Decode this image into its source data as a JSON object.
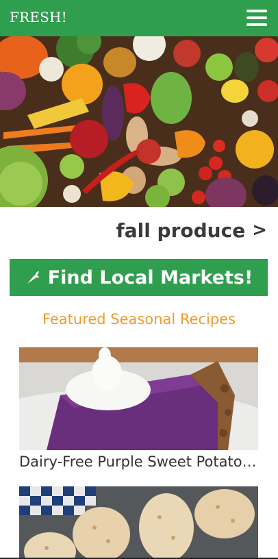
{
  "header": {
    "brand": "FRESH!",
    "menu_icon": "hamburger-menu-icon"
  },
  "hero": {
    "image": "assorted-fruits-and-vegetables"
  },
  "fall_link": {
    "label": "fall produce",
    "chevron": ">"
  },
  "cta": {
    "label": "Find Local Markets!",
    "icon": "carrot-icon"
  },
  "recipes": {
    "heading": "Featured Seasonal Recipes",
    "items": [
      {
        "title": "Dairy-Free Purple Sweet Potato Pie",
        "image": "purple-sweet-potato-pie"
      },
      {
        "title": "",
        "image": "baked-stuffed-potatoes"
      }
    ]
  },
  "colors": {
    "brand_green": "#2f9e4f",
    "accent_orange": "#f39a2c",
    "text_dark": "#3a3a3a"
  }
}
